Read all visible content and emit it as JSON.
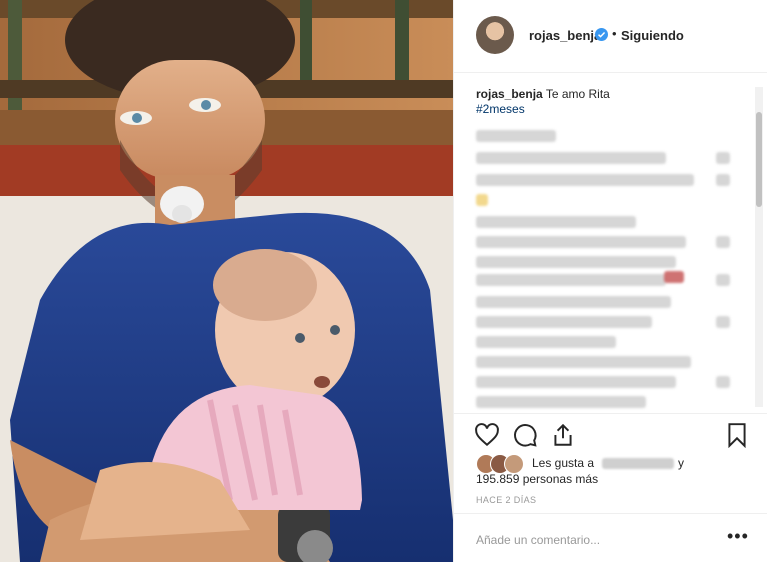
{
  "post": {
    "username": "rojas_benja",
    "separator": "•",
    "follow_status": "Siguiendo",
    "caption_text": "Te amo Rita",
    "hashtag": "#2meses",
    "likes_prefix": "Les gusta a",
    "likes_conjunction": "y",
    "likes_count": "195.859 personas más",
    "timestamp": "HACE 2 DÍAS",
    "comment_placeholder": "Añade un comentario...",
    "more_options": "•••"
  },
  "icons": [
    "verified-badge-icon",
    "heart-icon",
    "comment-icon",
    "share-icon",
    "bookmark-icon",
    "more-options-icon"
  ],
  "colors": {
    "accent": "#3897f0",
    "hashtag": "#003569",
    "muted": "#999999",
    "text": "#262626",
    "shirt": "#1f3a8a",
    "dress": "#f3c6d4"
  }
}
